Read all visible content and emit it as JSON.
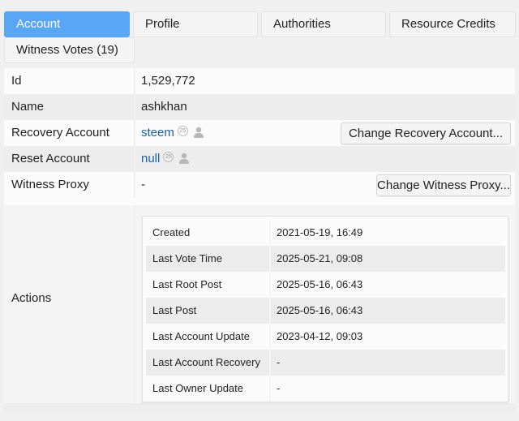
{
  "tabs": {
    "account": "Account",
    "profile": "Profile",
    "authorities": "Authorities",
    "resource_credits": "Resource Credits",
    "witness_votes": "Witness Votes (19)"
  },
  "fields": {
    "id_label": "Id",
    "id_value": "1,529,772",
    "name_label": "Name",
    "name_value": "ashkhan",
    "recovery_label": "Recovery Account",
    "recovery_value": "steem",
    "recovery_rep": "25",
    "reset_label": "Reset Account",
    "reset_value": "null",
    "reset_rep": "25",
    "proxy_label": "Witness Proxy",
    "proxy_value": "-",
    "actions_label": "Actions"
  },
  "buttons": {
    "change_recovery": "Change Recovery Account...",
    "change_proxy": "Change Witness Proxy..."
  },
  "actions": [
    {
      "label": "Created",
      "value": "2021-05-19, 16:49"
    },
    {
      "label": "Last Vote Time",
      "value": "2025-05-21, 09:08"
    },
    {
      "label": "Last Root Post",
      "value": "2025-05-16, 06:43"
    },
    {
      "label": "Last Post",
      "value": "2025-05-16, 06:43"
    },
    {
      "label": "Last Account Update",
      "value": "2023-04-12, 09:03"
    },
    {
      "label": "Last Account Recovery",
      "value": "-"
    },
    {
      "label": "Last Owner Update",
      "value": "-"
    }
  ],
  "colors": {
    "accent": "#58a6f5",
    "link": "#1b5fa8"
  }
}
